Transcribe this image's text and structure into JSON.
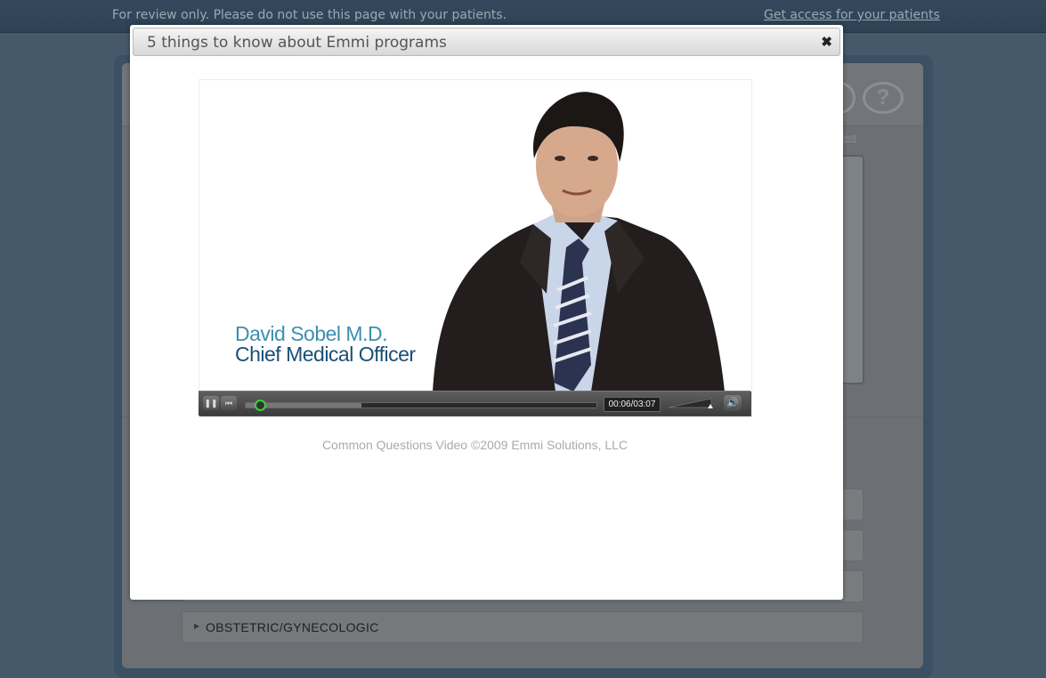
{
  "topbar": {
    "notice": "For review only. Please do not use this page with your patients.",
    "access_link": "Get access for your patients"
  },
  "background_page": {
    "help_icon": "question-mark-icon",
    "category_label": "OBSTETRIC/GYNECOLOGIC"
  },
  "modal": {
    "title": "5 things to know about Emmi programs",
    "close_glyph": "✖",
    "video": {
      "speaker_name": "David Sobel M.D.",
      "speaker_title": "Chief Medical Officer",
      "time_display": "00:06/03:07",
      "progress_fraction": 0.04,
      "buffered_fraction": 0.33,
      "play_state": "playing",
      "pause_glyph": "❚❚",
      "rewind_glyph": "⏮",
      "volume_glyph": "🔊"
    },
    "caption": "Common Questions Video ©2009 Emmi Solutions, LLC"
  },
  "colors": {
    "name_blue": "#3c8fb0",
    "title_navy": "#1a4f74",
    "progress_knob": "#3bd23b"
  }
}
